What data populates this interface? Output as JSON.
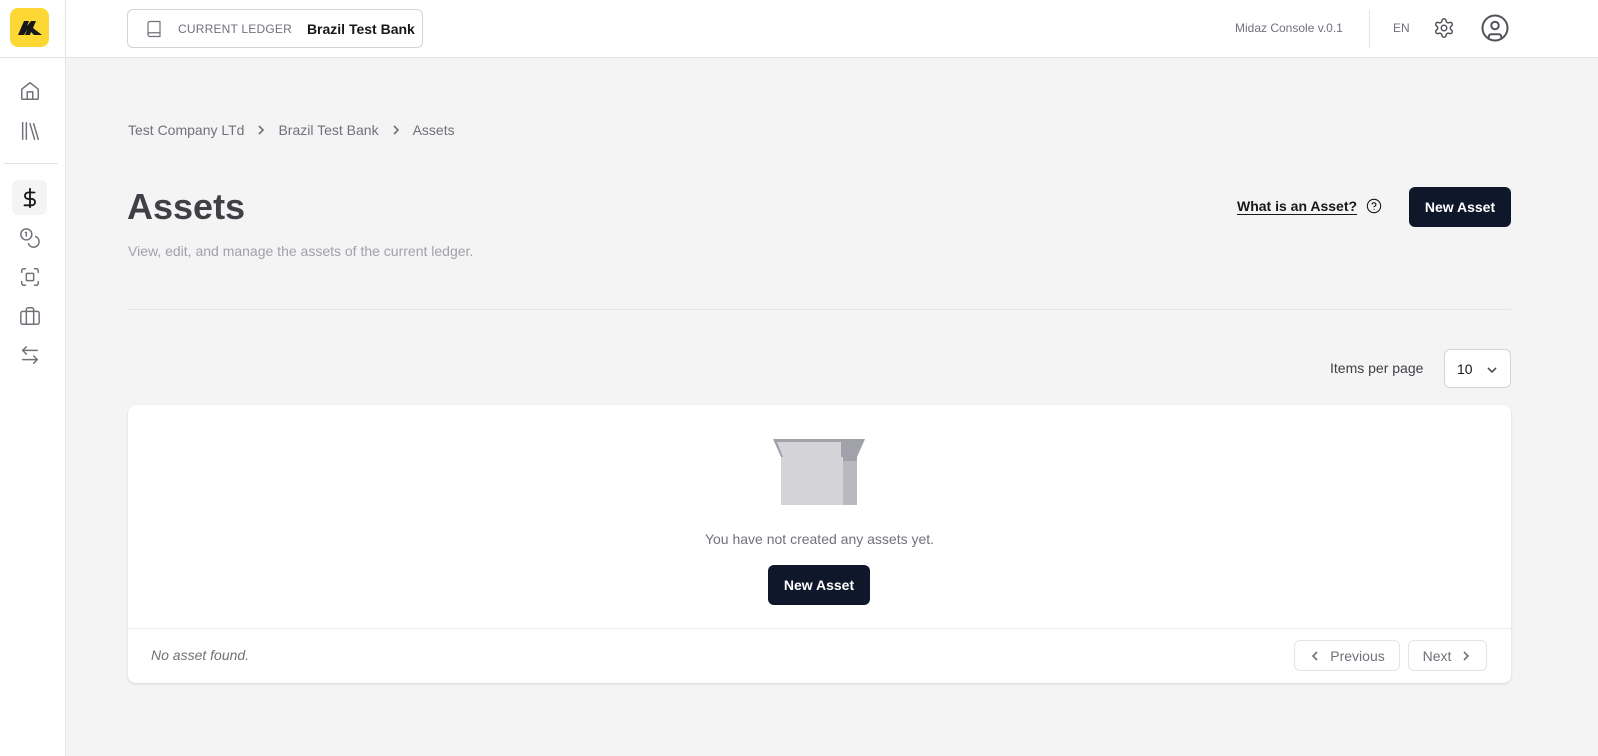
{
  "header": {
    "ledger_label": "CURRENT LEDGER",
    "ledger_name": "Brazil Test Bank",
    "version": "Midaz Console v.0.1",
    "language": "EN"
  },
  "sidebar": {
    "items": [
      {
        "name": "home",
        "icon": "home-icon"
      },
      {
        "name": "ledgers",
        "icon": "library-icon"
      },
      {
        "name": "assets",
        "icon": "dollar-icon",
        "active": true
      },
      {
        "name": "portfolios",
        "icon": "coins-icon"
      },
      {
        "name": "accounts",
        "icon": "scan-icon"
      },
      {
        "name": "products",
        "icon": "briefcase-icon"
      },
      {
        "name": "transactions",
        "icon": "arrow-left-right-icon"
      }
    ]
  },
  "breadcrumb": [
    "Test Company LTd",
    "Brazil Test Bank",
    "Assets"
  ],
  "page": {
    "title": "Assets",
    "subtitle": "View, edit, and manage the assets of the current ledger.",
    "help_link": "What is an Asset?",
    "new_button": "New Asset"
  },
  "pagination": {
    "items_per_page_label": "Items per page",
    "items_per_page_value": "10",
    "previous": "Previous",
    "next": "Next"
  },
  "empty_state": {
    "message": "You have not created any assets yet.",
    "button": "New Asset",
    "footer": "No asset found."
  },
  "colors": {
    "brand": "#fdd835",
    "primary": "#0f172a",
    "background": "#f4f4f5"
  }
}
